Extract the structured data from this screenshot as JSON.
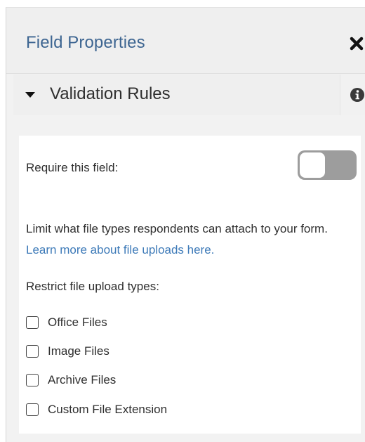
{
  "header": {
    "title": "Field Properties",
    "close_icon": "close-icon"
  },
  "section": {
    "title": "Validation Rules",
    "expanded": true,
    "caret_icon": "caret-down-icon",
    "info_icon": "info-icon"
  },
  "require": {
    "label": "Require this field:",
    "enabled": false
  },
  "description": {
    "text": "Limit what file types respondents can attach to your form.",
    "link_text": "Learn more about file uploads here."
  },
  "restrict": {
    "label": "Restrict file upload types:",
    "options": [
      {
        "label": "Office Files",
        "checked": false
      },
      {
        "label": "Image Files",
        "checked": false
      },
      {
        "label": "Archive Files",
        "checked": false
      },
      {
        "label": "Custom File Extension",
        "checked": false
      }
    ]
  },
  "colors": {
    "title_blue": "#3d6591",
    "link_blue": "#3d7ab8",
    "toggle_off": "#9d9d9d"
  }
}
